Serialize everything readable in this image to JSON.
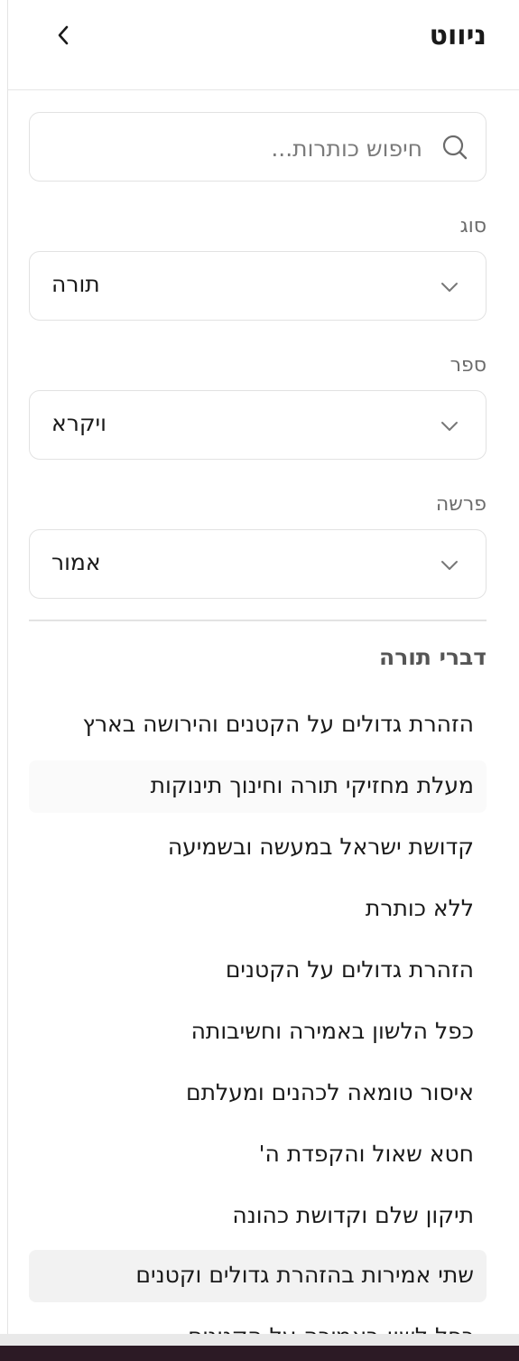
{
  "header": {
    "title": "ניווט"
  },
  "search": {
    "placeholder": "חיפוש כותרות..."
  },
  "filters": {
    "type": {
      "label": "סוג",
      "value": "תורה"
    },
    "book": {
      "label": "ספר",
      "value": "ויקרא"
    },
    "portion": {
      "label": "פרשה",
      "value": "אמור"
    }
  },
  "section": {
    "title": "דברי תורה",
    "items": [
      "הזהרת גדולים על הקטנים והירושה בארץ",
      "מעלת מחזיקי תורה וחינוך תינוקות",
      "קדושת ישראל במעשה ובשמיעה",
      "ללא כותרת",
      "הזהרת גדולים על הקטנים",
      "כפל הלשון באמירה וחשיבותה",
      "איסור טומאה לכהנים ומעלתם",
      "חטא שאול והקפדת ה'",
      "תיקון שלם וקדושת כהונה",
      "שתי אמירות בהזהרת גדולים וקטנים",
      "כפל לשון באמירה על הקטנים"
    ]
  },
  "colors": {
    "taskbar": "#2c1a25",
    "selected_item": "#f2f2f2",
    "border": "#e2e2e2"
  },
  "icons": [
    "chevron-left-icon",
    "search-icon",
    "chevron-down-icon"
  ]
}
